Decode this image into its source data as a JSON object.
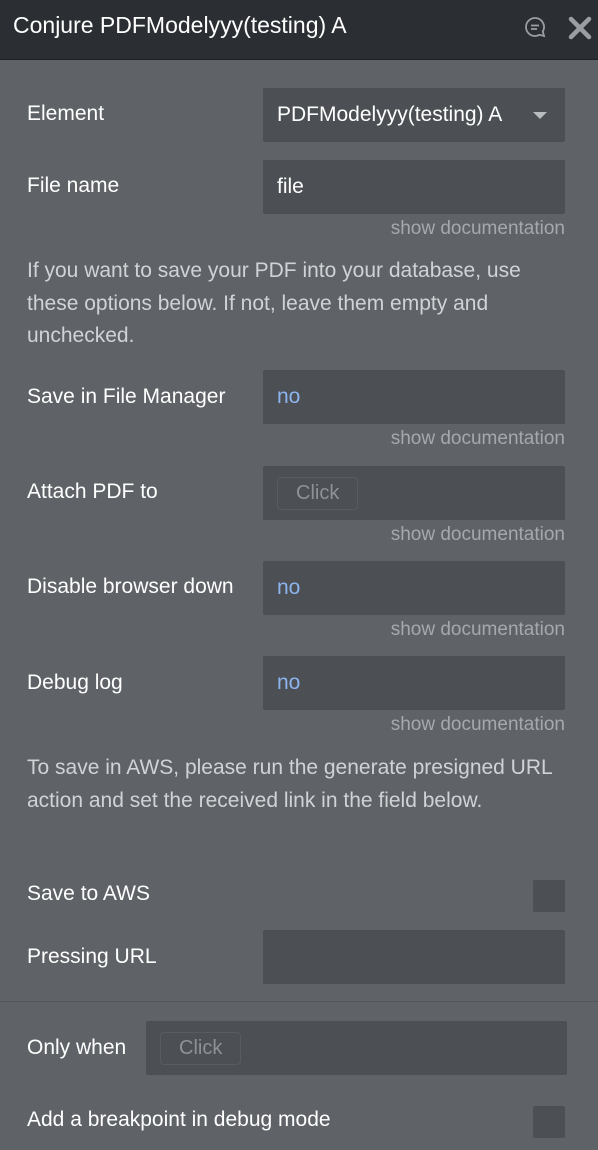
{
  "header": {
    "title": "Conjure PDFModelyyy(testing) A",
    "icons": [
      "comment-icon",
      "close-icon"
    ]
  },
  "fields": {
    "element": {
      "label": "Element",
      "value": "PDFModelyyy(testing) A"
    },
    "file_name": {
      "label": "File name",
      "value": "file",
      "doc": "show documentation"
    },
    "info_database": "If you want to save your PDF into your database, use these options below. If not, leave them empty and unchecked.",
    "save_file_manager": {
      "label": "Save in File Manager",
      "value": "no",
      "doc": "show documentation"
    },
    "attach_pdf": {
      "label": "Attach PDF to",
      "placeholder": "Click",
      "doc": "show documentation"
    },
    "disable_browser": {
      "label": "Disable browser down",
      "value": "no",
      "doc": "show documentation"
    },
    "debug_log": {
      "label": "Debug log",
      "value": "no",
      "doc": "show documentation"
    },
    "info_aws": "To save in AWS, please run the generate presigned URL action and set the received link in the field below.",
    "save_aws": {
      "label": "Save to AWS",
      "checked": false
    },
    "pressing_url": {
      "label": "Pressing URL",
      "value": ""
    }
  },
  "conditions": {
    "only_when": {
      "label": "Only when",
      "placeholder": "Click"
    },
    "breakpoint": {
      "label": "Add a breakpoint in debug mode",
      "checked": false
    }
  },
  "colors": {
    "background": "#5f6367",
    "titlebar": "#2b2f33",
    "field": "#4c5054",
    "yesno_value": "#8db4ee",
    "doc_link": "#a5a9ad"
  }
}
